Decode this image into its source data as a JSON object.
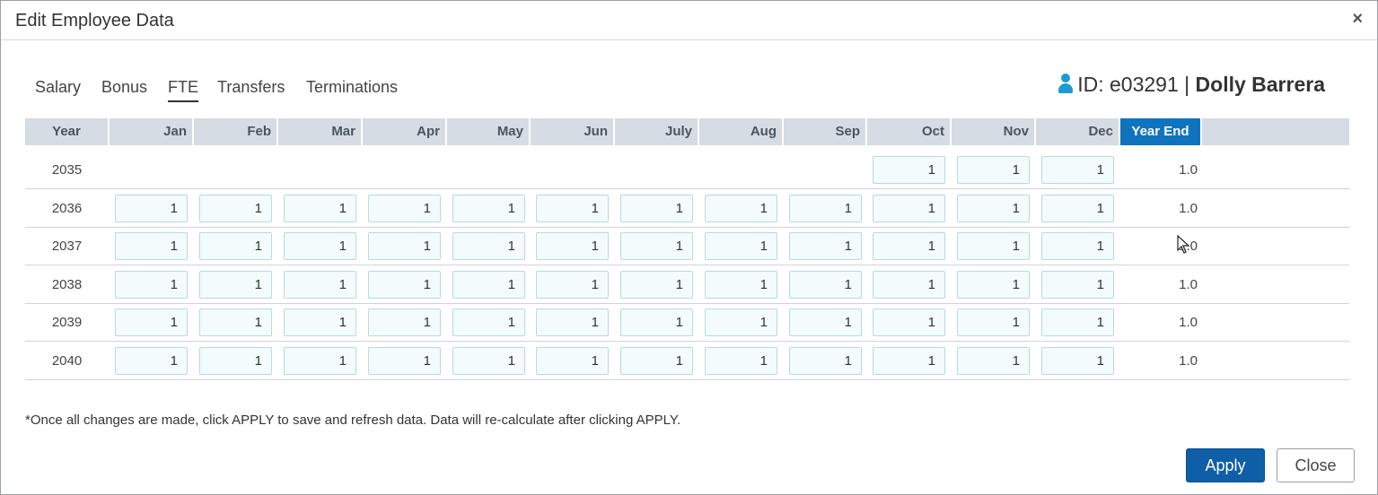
{
  "dialog": {
    "title": "Edit Employee Data",
    "close_glyph": "×"
  },
  "tabs": [
    {
      "label": "Salary",
      "active": false
    },
    {
      "label": "Bonus",
      "active": false
    },
    {
      "label": "FTE",
      "active": true
    },
    {
      "label": "Transfers",
      "active": false
    },
    {
      "label": "Terminations",
      "active": false
    }
  ],
  "employee": {
    "icon": "person-icon",
    "id_text": "ID: e03291 | ",
    "name": "Dolly Barrera"
  },
  "table": {
    "columns": [
      "Year",
      "Jan",
      "Feb",
      "Mar",
      "Apr",
      "May",
      "Jun",
      "July",
      "Aug",
      "Sep",
      "Oct",
      "Nov",
      "Dec",
      "Year End"
    ],
    "rows": [
      {
        "year": "2035",
        "months": [
          "",
          "",
          "",
          "",
          "",
          "",
          "",
          "",
          "",
          "1",
          "1",
          "1"
        ],
        "year_end": "1.0"
      },
      {
        "year": "2036",
        "months": [
          "1",
          "1",
          "1",
          "1",
          "1",
          "1",
          "1",
          "1",
          "1",
          "1",
          "1",
          "1"
        ],
        "year_end": "1.0"
      },
      {
        "year": "2037",
        "months": [
          "1",
          "1",
          "1",
          "1",
          "1",
          "1",
          "1",
          "1",
          "1",
          "1",
          "1",
          "1"
        ],
        "year_end": "1.0"
      },
      {
        "year": "2038",
        "months": [
          "1",
          "1",
          "1",
          "1",
          "1",
          "1",
          "1",
          "1",
          "1",
          "1",
          "1",
          "1"
        ],
        "year_end": "1.0"
      },
      {
        "year": "2039",
        "months": [
          "1",
          "1",
          "1",
          "1",
          "1",
          "1",
          "1",
          "1",
          "1",
          "1",
          "1",
          "1"
        ],
        "year_end": "1.0"
      },
      {
        "year": "2040",
        "months": [
          "1",
          "1",
          "1",
          "1",
          "1",
          "1",
          "1",
          "1",
          "1",
          "1",
          "1",
          "1"
        ],
        "year_end": "1.0"
      }
    ]
  },
  "footnote": "*Once all changes are made, click APPLY to save and refresh data. Data will re-calculate after clicking APPLY.",
  "buttons": {
    "apply": "Apply",
    "close": "Close"
  },
  "colors": {
    "accent": "#0f74bd",
    "apply_button": "#0f5ea8",
    "person_icon": "#1a9bd7",
    "header_bg": "#d5dce3",
    "input_bg": "#f3fbfd"
  }
}
